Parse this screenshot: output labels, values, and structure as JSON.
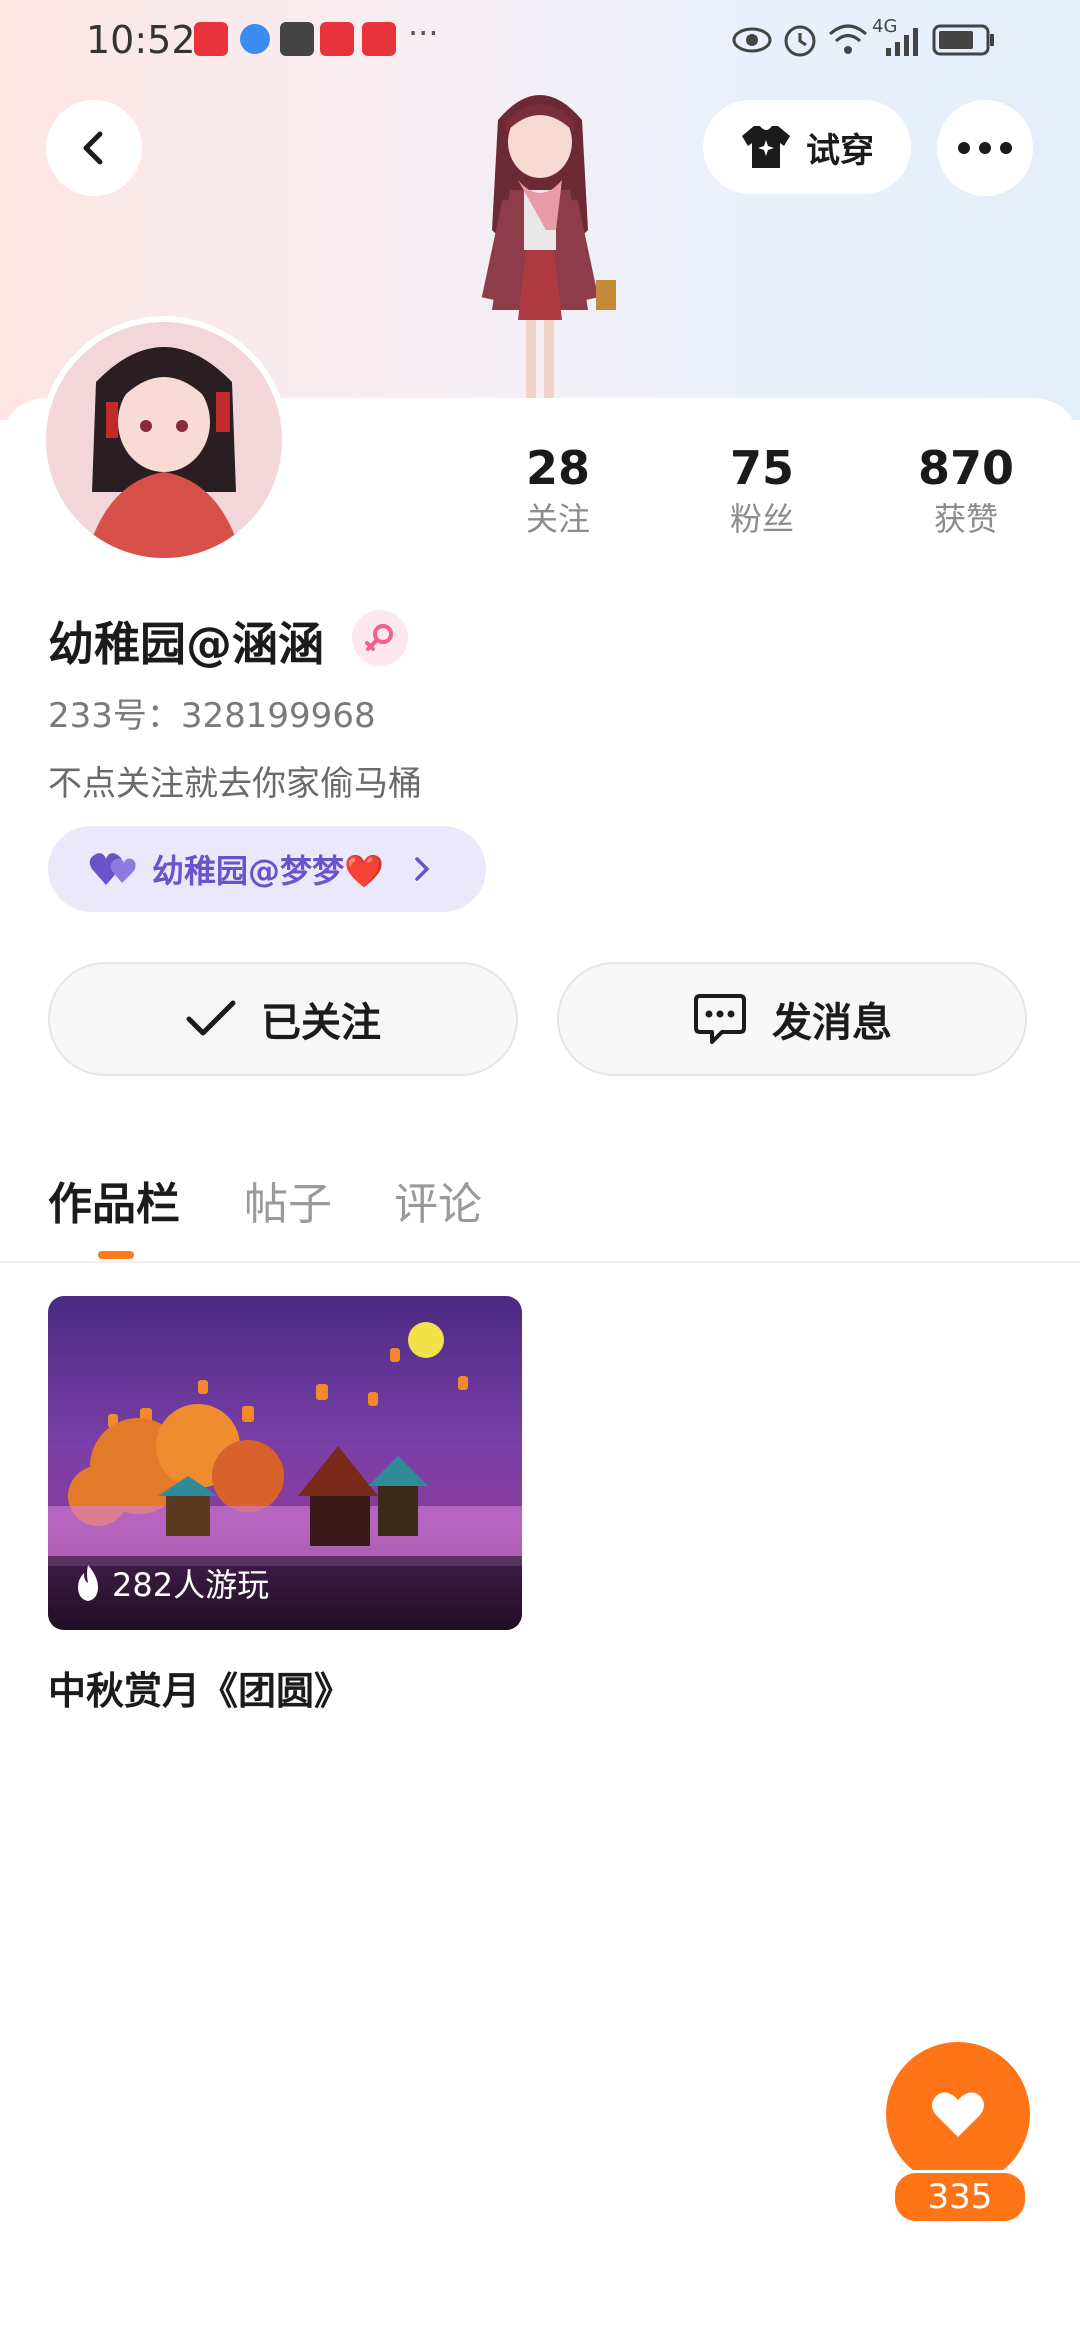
{
  "status_bar": {
    "time": "10:52",
    "network": "4G"
  },
  "header": {
    "try_on_label": "试穿"
  },
  "profile": {
    "stats": [
      {
        "num": "28",
        "label": "关注"
      },
      {
        "num": "75",
        "label": "粉丝"
      },
      {
        "num": "870",
        "label": "获赞"
      }
    ],
    "username": "幼稚园@涵涵",
    "uid": "233号：328199968",
    "bio": "不点关注就去你家偷马桶",
    "couple_name": "幼稚园@梦梦❤️"
  },
  "actions": {
    "followed_label": "已关注",
    "message_label": "发消息"
  },
  "tabs": [
    {
      "label": "作品栏"
    },
    {
      "label": "帖子"
    },
    {
      "label": "评论"
    }
  ],
  "works": [
    {
      "plays": "282人游玩",
      "title": "中秋赏月《团圆》"
    }
  ],
  "like": {
    "count": "335"
  },
  "colors": {
    "accent": "#ff7416",
    "couple_bg": "#ece8fb",
    "couple_text": "#6a52c9"
  }
}
